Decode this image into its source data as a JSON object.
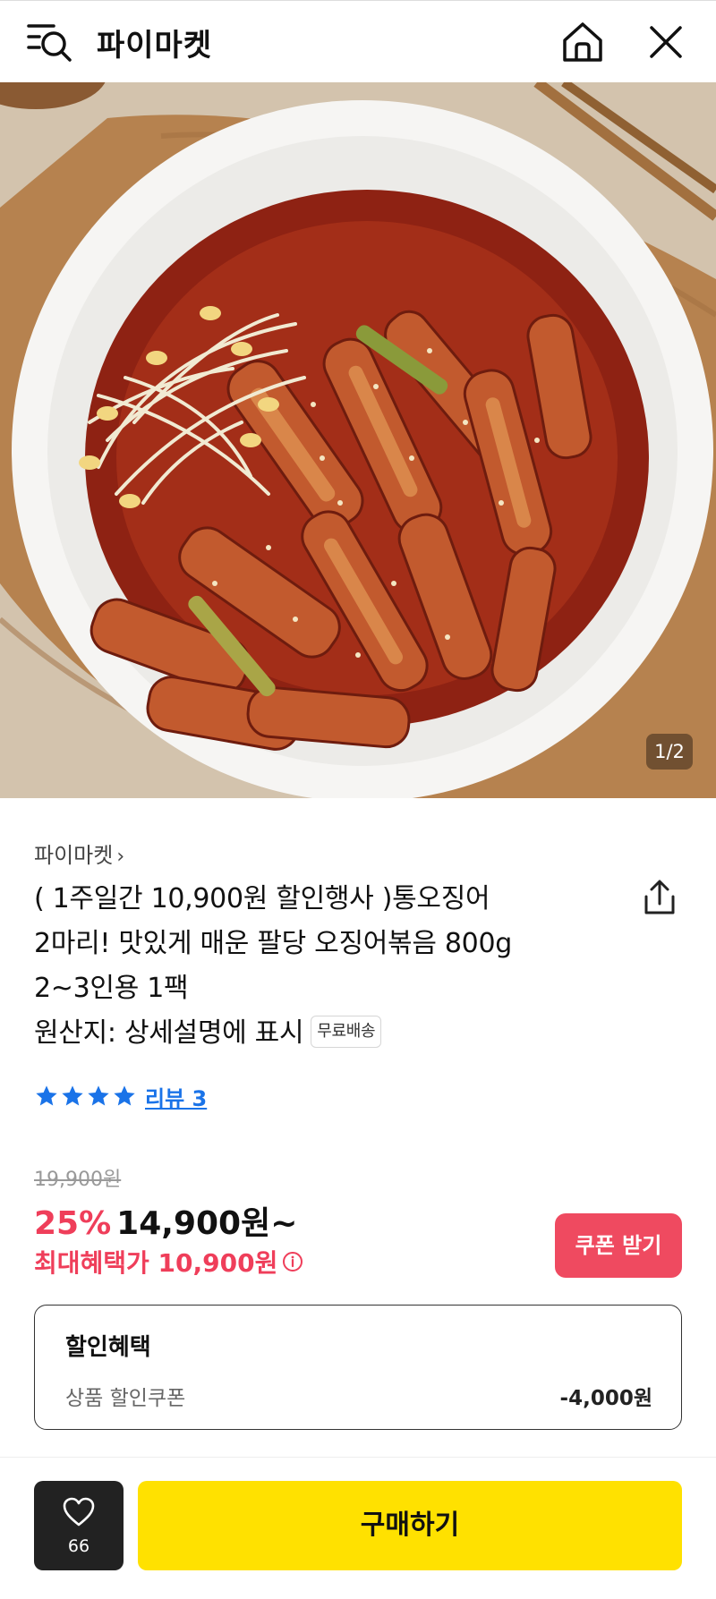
{
  "header": {
    "shop_name": "파이마켓",
    "icons": [
      "menu-search-icon",
      "home-icon",
      "close-icon"
    ]
  },
  "gallery": {
    "page_indicator": "1/2"
  },
  "product": {
    "seller_name": "파이마켓",
    "seller_chevron": "›",
    "title_lines": [
      "( 1주일간 10,900원 할인행사 )통오징어",
      "2마리! 맛있게 매운 팔당 오징어볶음 800g",
      "2~3인용 1팩",
      "원산지: 상세설명에 표시"
    ],
    "free_shipping_badge": "무료배송",
    "rating_stars": 4,
    "review_label": "리뷰 3"
  },
  "pricing": {
    "original_price": "19,900원",
    "discount_rate": "25%",
    "sale_price": "14,900원~",
    "max_benefit_label": "최대혜택가 10,900원",
    "coupon_button": "쿠폰 받기"
  },
  "benefits": {
    "title": "할인혜택",
    "item_label": "상품 할인쿠폰",
    "item_amount": "-4,000원"
  },
  "footer": {
    "like_count": "66",
    "buy_button": "구매하기"
  },
  "colors": {
    "accent_red": "#ef3e5a",
    "buy_yellow": "#ffe100",
    "star_blue": "#1a73e8"
  }
}
